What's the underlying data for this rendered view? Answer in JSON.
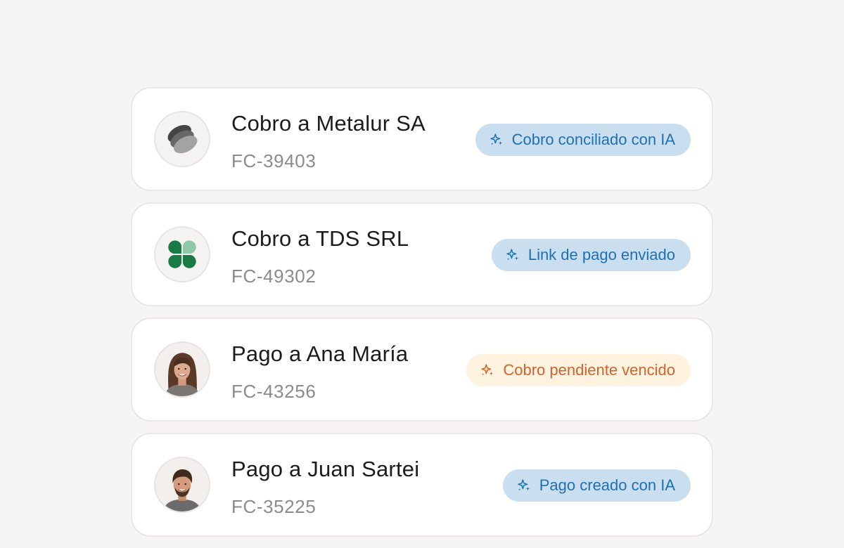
{
  "colors": {
    "background": "#f6f5f3",
    "card": "#ffffff",
    "pill_blue_bg": "#c9dff0",
    "pill_blue_text": "#1f70b3",
    "pill_orange_bg": "#fdf3df",
    "pill_orange_text": "#d4622d"
  },
  "transactions": [
    {
      "title": "Cobro a Metalur SA",
      "reference": "FC-39403",
      "avatar_icon": "metalur-logo-icon",
      "status_icon": "sparkle-icon",
      "status": "Cobro conciliado con IA",
      "status_color": "blue"
    },
    {
      "title": "Cobro a TDS SRL",
      "reference": "FC-49302",
      "avatar_icon": "tds-clover-logo-icon",
      "status_icon": "sparkle-icon",
      "status": "Link de pago enviado",
      "status_color": "blue"
    },
    {
      "title": "Pago a Ana María",
      "reference": "FC-43256",
      "avatar_icon": "person-avatar-icon",
      "status_icon": "sparkle-icon",
      "status": "Cobro pendiente vencido",
      "status_color": "orange"
    },
    {
      "title": "Pago a Juan Sartei",
      "reference": "FC-35225",
      "avatar_icon": "person-avatar-icon",
      "status_icon": "sparkle-icon",
      "status": "Pago creado con IA",
      "status_color": "blue"
    }
  ]
}
